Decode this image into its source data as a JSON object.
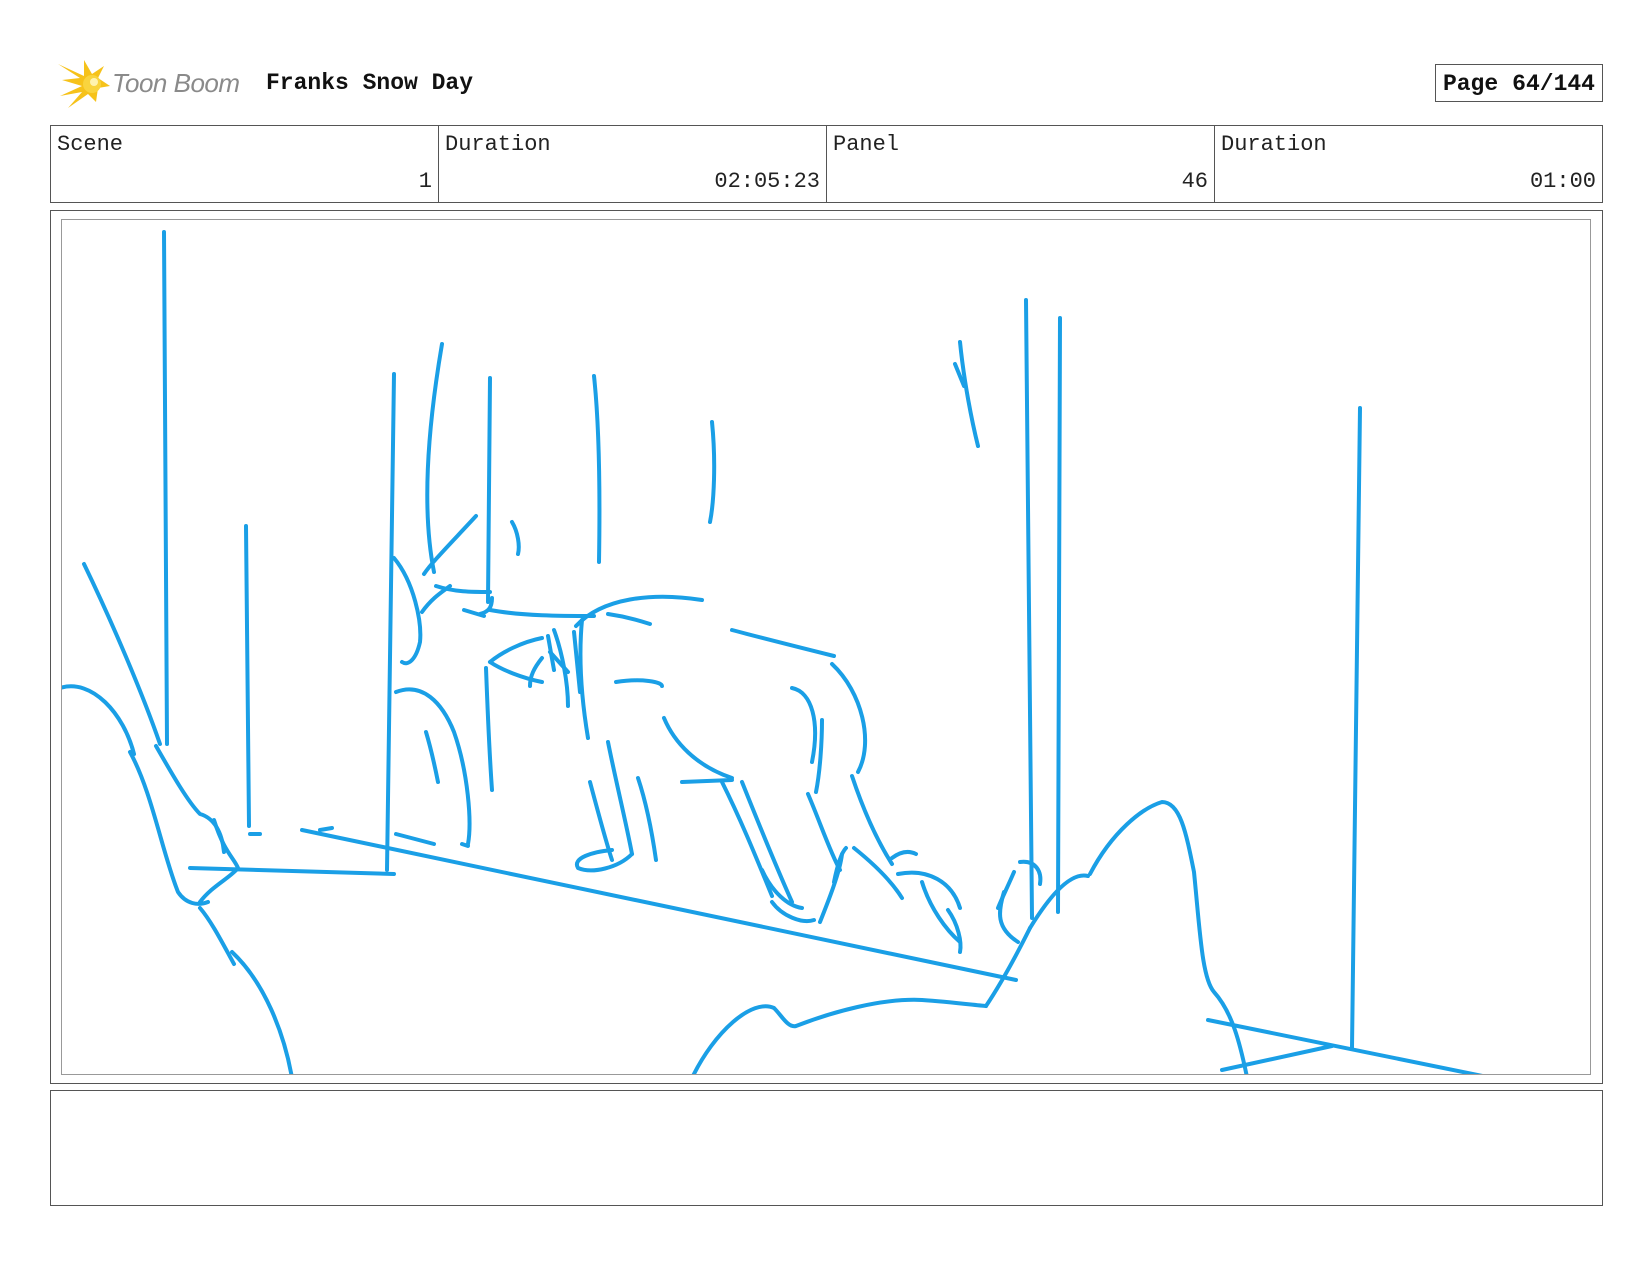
{
  "header": {
    "brand": "Toon Boom",
    "project_title": "Franks Snow Day",
    "page_label": "Page",
    "page_number": "64/144"
  },
  "info": {
    "scene_label": "Scene",
    "scene_value": "1",
    "scene_duration_label": "Duration",
    "scene_duration_value": "02:05:23",
    "panel_label": "Panel",
    "panel_value": "46",
    "panel_duration_label": "Duration",
    "panel_duration_value": "01:00"
  },
  "notes": {
    "text": ""
  },
  "colors": {
    "sketch_line": "#1a9fe6",
    "logo_yellow": "#f6c21a",
    "border": "#555555"
  }
}
